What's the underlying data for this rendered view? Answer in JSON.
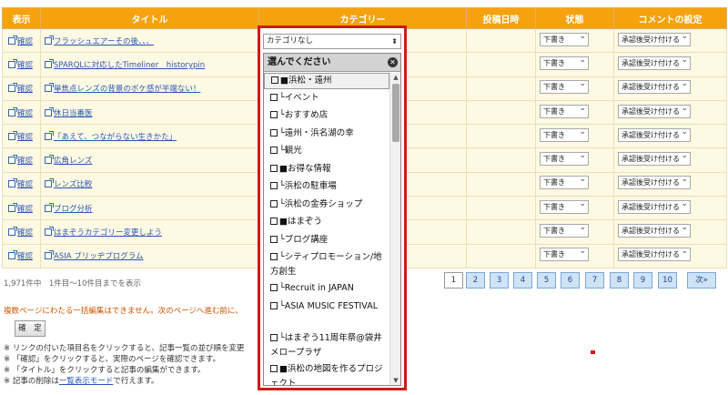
{
  "headers": {
    "view": "表示",
    "title": "タイトル",
    "category": "カテゴリー",
    "post_date": "投稿日時",
    "status": "状態",
    "comment": "コメントの設定"
  },
  "rows": [
    {
      "view": "確認",
      "title": "フラッシュエアーその後、、、",
      "status": "下書き",
      "comment": "承認後受け付ける"
    },
    {
      "view": "確認",
      "title": "SPARQLに対応したTimeliner　historypin",
      "status": "下書き",
      "comment": "承認後受け付ける"
    },
    {
      "view": "確認",
      "title": "単焦点レンズの背景のボケ感が半端ない！",
      "status": "下書き",
      "comment": "承認後受け付ける"
    },
    {
      "view": "確認",
      "title": "休日当番医",
      "status": "下書き",
      "comment": "承認後受け付ける"
    },
    {
      "view": "確認",
      "title": "「あえて、つながらない生きかた」",
      "status": "下書き",
      "comment": "承認後受け付ける"
    },
    {
      "view": "確認",
      "title": "広角レンズ",
      "status": "下書き",
      "comment": "承認後受け付ける"
    },
    {
      "view": "確認",
      "title": "レンズ比較",
      "status": "下書き",
      "comment": "承認後受け付ける"
    },
    {
      "view": "確認",
      "title": "ブログ分析",
      "status": "下書き",
      "comment": "承認後受け付ける"
    },
    {
      "view": "確認",
      "title": "はまぞうカテゴリー変更しよう",
      "status": "下書き",
      "comment": "承認後受け付ける"
    },
    {
      "view": "確認",
      "title": "ASIA ブリッヂプログラム",
      "status": "下書き",
      "comment": "承認後受け付ける"
    }
  ],
  "category_dropdown": {
    "selected": "カテゴリなし",
    "panel_title": "選んでください",
    "options": [
      "■浜松・遠州",
      "└イベント",
      "└おすすめ店",
      "└遠州・浜名湖の幸",
      "└観光",
      "■お得な情報",
      "└浜松の駐車場",
      "└浜松の金券ショップ",
      "■はまぞう",
      "└ブログ講座",
      "└シティプロモーション/地方創生",
      "└Recruit in JAPAN",
      "└ASIA MUSIC FESTIVAL",
      "└はまぞう11周年祭@袋井メロープラザ",
      "■浜松の地図を作るプロジェクト"
    ]
  },
  "summary": "1,971件中　1件目〜10件目までを表示",
  "pagination": {
    "pages": [
      "1",
      "2",
      "3",
      "4",
      "5",
      "6",
      "7",
      "8",
      "9",
      "10"
    ],
    "current": "1",
    "next_label": "次»"
  },
  "warning": "複数ページにわたる一括編集はできません。次のページへ進む前に、",
  "confirm_button": "確　定",
  "notes": [
    {
      "text": "※ リンクの付いた項目名をクリックすると、記事一覧の並び順を変更"
    },
    {
      "text": "※ 「確認」をクリックすると、実際のページを確認できます。"
    },
    {
      "text": "※ 「タイトル」をクリックすると記事の編集ができます。"
    },
    {
      "pre": "※ 記事の削除は",
      "link": "一覧表示モード",
      "post": "で行えます。"
    }
  ]
}
